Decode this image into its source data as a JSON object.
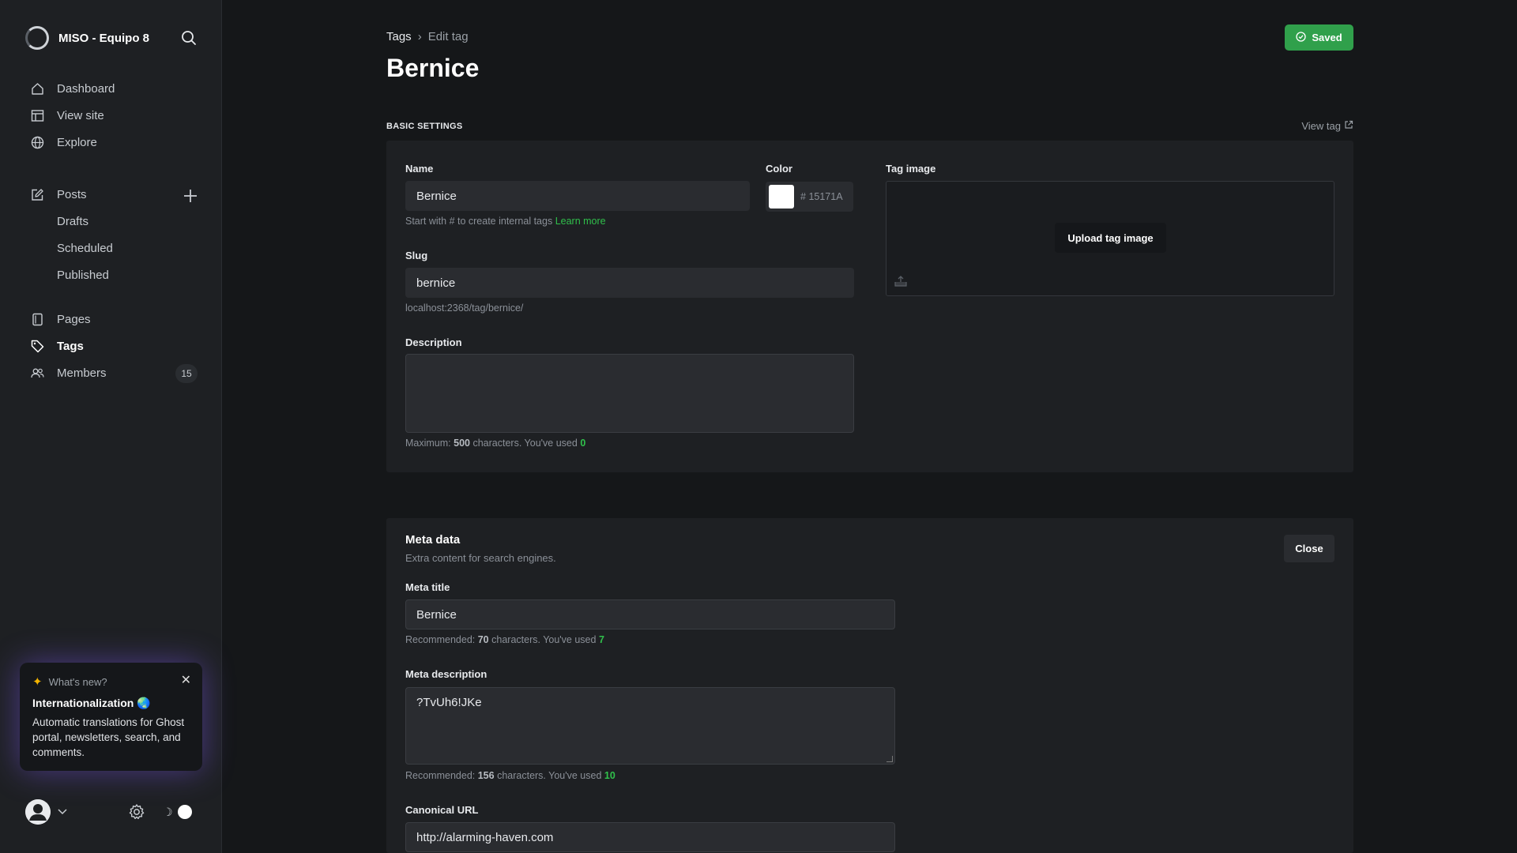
{
  "sidebar": {
    "site_name": "MISO - Equipo 8",
    "nav": {
      "dashboard": "Dashboard",
      "view_site": "View site",
      "explore": "Explore",
      "posts": "Posts",
      "drafts": "Drafts",
      "scheduled": "Scheduled",
      "published": "Published",
      "pages": "Pages",
      "tags": "Tags",
      "members": "Members",
      "members_count": "15"
    },
    "active_item": "Tags",
    "whats_new": {
      "heading": "What's new?",
      "title": "Internationalization 🌏",
      "body": "Automatic translations for Ghost portal, newsletters, search, and comments."
    }
  },
  "header": {
    "breadcrumb_parent": "Tags",
    "breadcrumb_separator": "›",
    "breadcrumb_current": "Edit tag",
    "title": "Bernice",
    "saved_label": "Saved"
  },
  "basic": {
    "section_label": "BASIC SETTINGS",
    "view_tag_label": "View tag",
    "name_label": "Name",
    "name_value": "Bernice",
    "name_hint": "Start with # to create internal tags",
    "learn_more": "Learn more",
    "color_label": "Color",
    "color_hash": "#",
    "color_value": "15171A",
    "tag_image_label": "Tag image",
    "upload_label": "Upload tag image",
    "slug_label": "Slug",
    "slug_value": "bernice",
    "slug_url": "localhost:2368/tag/bernice/",
    "description_label": "Description",
    "description_value": "",
    "desc_hint_prefix": "Maximum:",
    "desc_max": "500",
    "desc_hint_mid": "characters. You've used",
    "desc_used": "0"
  },
  "meta": {
    "title": "Meta data",
    "subtitle": "Extra content for search engines.",
    "close_label": "Close",
    "meta_title_label": "Meta title",
    "meta_title_value": "Bernice",
    "mt_hint_prefix": "Recommended:",
    "mt_recommended": "70",
    "mt_hint_mid": "characters. You've used",
    "mt_used": "7",
    "meta_desc_label": "Meta description",
    "meta_desc_value": "?TvUh6!JKe",
    "md_hint_prefix": "Recommended:",
    "md_recommended": "156",
    "md_hint_mid": "characters. You've used",
    "md_used": "10",
    "canonical_label": "Canonical URL",
    "canonical_value": "http://alarming-haven.com"
  },
  "colors": {
    "accent_green": "#30a04b",
    "background": "#151719",
    "panel": "#1e2023"
  }
}
